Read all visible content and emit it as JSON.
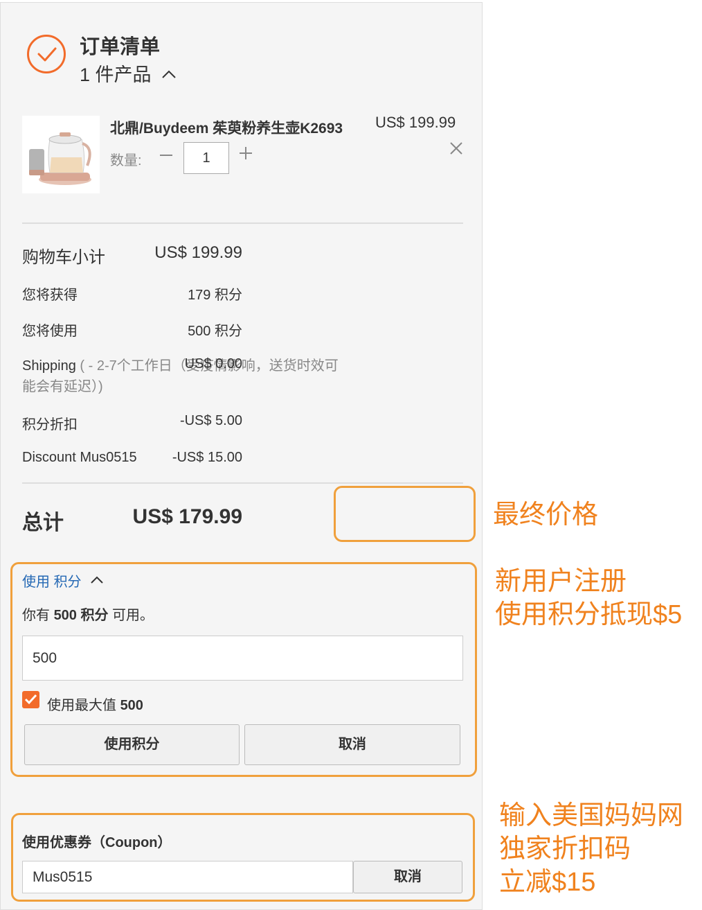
{
  "summary": {
    "title": "订单清单",
    "item_count": "1 件产品"
  },
  "product": {
    "name": "北鼎/Buydeem 茱萸粉养生壶K2693",
    "price": "US$ 199.99",
    "qty_label": "数量:",
    "qty_value": "1"
  },
  "totals": {
    "rows": [
      {
        "label": "购物车小计",
        "value": "US$ 199.99"
      },
      {
        "label": "您将获得",
        "value": "179 积分"
      },
      {
        "label": "您将使用",
        "value": "500 积分"
      },
      {
        "label": "Shipping",
        "note": " ( - 2-7个工作日（受疫情影响，送货时效可能会有延迟）)",
        "value": "US$ 0.00"
      },
      {
        "label": "积分折扣",
        "value": "-US$ 5.00"
      },
      {
        "label": "Discount Mus0515",
        "value": "-US$ 15.00"
      }
    ],
    "total_label": "总计",
    "total_value": "US$ 179.99"
  },
  "points": {
    "title_a": "使用",
    "title_b": "积分",
    "avail_pre": "你有 ",
    "avail_bold": "500 积分",
    "avail_post": " 可用。",
    "input_value": "500",
    "max_label": "使用最大值 ",
    "max_value": "500",
    "apply_button": "使用积分",
    "cancel_button": "取消",
    "checked": true
  },
  "coupon": {
    "title": "使用优惠券（Coupon）",
    "input_value": "Mus0515",
    "cancel_button": "取消"
  },
  "annotations": {
    "final_price": "最终价格",
    "new_user_line1": "新用户注册",
    "new_user_line2": "使用积分抵现$5",
    "coupon_line1": "输入美国妈妈网",
    "coupon_line2": "独家折扣码",
    "coupon_line3": "立减$15"
  },
  "colors": {
    "accent": "#f26b2a",
    "highlight": "#f0a03c",
    "annotation": "#f0821e",
    "link": "#2468b4"
  }
}
